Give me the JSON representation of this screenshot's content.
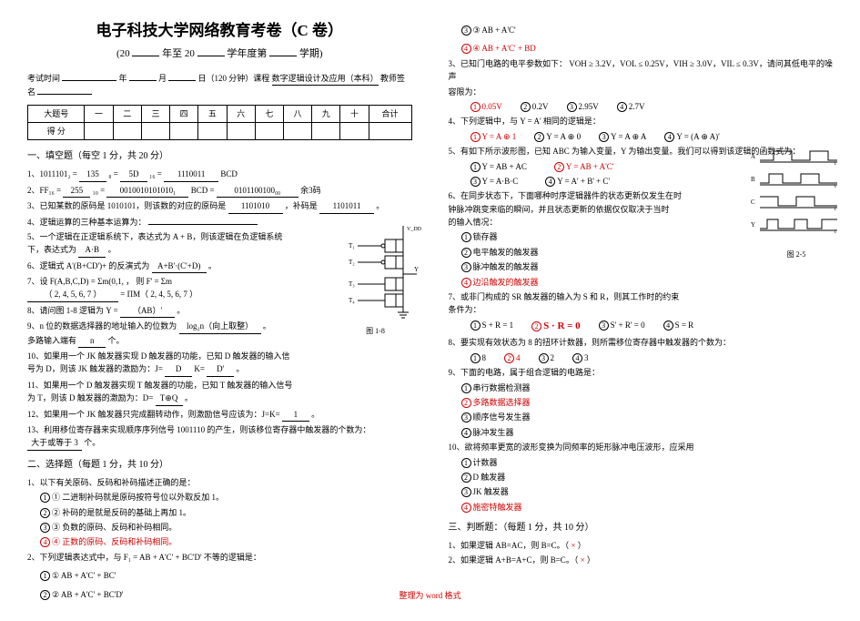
{
  "header": {
    "title": "电子科技大学网络教育考卷（C 卷）",
    "subtitle_a": "(20",
    "subtitle_b": "年至 20",
    "subtitle_c": "学年度第",
    "subtitle_d": "学期)",
    "meta_exam_time": "考试时间",
    "meta_year": "年",
    "meta_month": "月",
    "meta_day": "日（120 分钟）课程",
    "meta_course": "数字逻辑设计及应用（本科）",
    "meta_teacher": "教师签名"
  },
  "score_table": {
    "row1_label": "大题号",
    "cols": [
      "一",
      "二",
      "三",
      "四",
      "五",
      "六",
      "七",
      "八",
      "九",
      "十",
      "合计"
    ],
    "row2_label": "得  分"
  },
  "sec1": {
    "head": "一、填空题（每空 1 分，共 20 分）",
    "q1a": "1、1011101₂ =",
    "q1b": "135",
    "q1c": "₈ =",
    "q1d": "5D",
    "q1e": "₁₆ =",
    "q1f": "1110011",
    "q1g": "BCD",
    "q2a": "2、FF₁₆ =",
    "q2b": "255",
    "q2c": "₁₀ =",
    "q2d": "0010010101010₁",
    "q2e": "BCD =",
    "q2f": "0101100100₀₀",
    "q2g": "余3码",
    "q3a": "3、已知某数的原码是 1010101，则该数的对应的原码是",
    "q3b": "1101010",
    "q3c": "，补码是",
    "q3d": "1101011",
    "q3e": "。",
    "q4": "4、逻辑运算的三种基本运算为：",
    "q5a": "5、一个逻辑在正逻辑系统下，表达式为 A + B，则该逻辑在负逻辑系统",
    "q5b": "下，表达式为",
    "q5c": "A·B",
    "q5d": "。",
    "q6a": "6、逻辑式 A'(B+CD')+ 的反演式为",
    "q6b": "A+B'·(C'+D)",
    "q6c": "。",
    "q7a": "7、设",
    "q7b": "F(A,B,C,D) = Σm(0,1,",
    "q7c": "，    则",
    "q7d": "F' = Σm",
    "q7e": "（   2, 4, 5, 6, 7   ）",
    "q7f": " = ΠM（   2, 4, 5, 6, 7   ）",
    "q8a": "8、请问图 1-8 逻辑为 Y =",
    "q8b": "（AB）'",
    "q8c": "。",
    "q9a": "9、n 位的数据选择器的地址输入的位数为",
    "q9b": "log₂n（向上取整）",
    "q9c": "。",
    "q9d": "多路输入端有",
    "q9e": "n",
    "q9f": "个。",
    "q10a": "10、如果用一个 JK 触发器实现 D 触发器的功能，已知 D 触发器的输入信",
    "q10b": "号为 D，则该 JK 触发器的激励为：J=",
    "q10c": "D",
    "q10d": "K=",
    "q10e": "D'",
    "q10f": "。",
    "q11a": "11、如果用一个 D 触发器实现 T 触发器的功能，已知 T 触发器的输入信号",
    "q11b": "为 T，则该 D 触发器的激励为：D=",
    "q11c": "T⊕Q",
    "q11d": "。",
    "q12a": "12、如果用一个 JK 触发器只完成翻转动作，则激励信号应该为：J=K=",
    "q12b": "1",
    "q12c": "。",
    "q13a": "13、利用移位寄存器来实现顺序序列信号 1001110 的产生，则该移位寄存器中触发器的个数为：",
    "q13b": "大于或等于 3",
    "q13c": "个。",
    "fig_label": "图 1-8"
  },
  "sec2": {
    "head": "二、选择题（每题 1 分，共 10 分）",
    "q1": "1、以下有关原码、反码和补码描述正确的是：",
    "q1o1": "① 二进制补码就是原码按符号位以外取反加 1。",
    "q1o2": "② 补码的是就是反码的基础上再加 1。",
    "q1o3": "③ 负数的原码、反码和补码相同。",
    "q1o4": "④ 正数的原码、反码和补码相同。",
    "q2": "2、下列逻辑表达式中，与 F₁ = AB + A'C' + BC'D' 不等的逻辑是：",
    "q2o1": "① AB + A'C' + BC'",
    "q2o2": "② AB + A'C' + BC'D'",
    "q2o3": "③ AB + A'C'",
    "q2o4": "④ AB + A'C' + BD"
  },
  "col2": {
    "q3a": "3、已知门电路的电平参数如下：",
    "q3b": "VOH ≥ 3.2V，VOL ≤ 0.25V，VIH ≥ 3.0V，VIL ≤ 0.3V，请问其低电平的噪声",
    "q3c": "容限为：",
    "q3o1": "0.05V",
    "q3o2": "0.2V",
    "q3o3": "2.95V",
    "q3o4": "2.7V",
    "q4": "4、下列逻辑中，与 Y = A' 相同的逻辑是：",
    "q4o1": "Y = A ⊕ 1",
    "q4o2": "Y = A ⊕ 0",
    "q4o3": "Y = A ⊕ A",
    "q4o4": "Y = (A ⊕ A)'",
    "q5a": "5、有如下所示波形图，已知 ABC 为输入变量，Y 为输出变量。我们可以得到该逻辑的函数式为：",
    "q5o1": "Y = AB + AC",
    "q5o2": "Y = AB + A'C'",
    "q5o3": "Y = A·B·C",
    "q5o4": "Y = A' + B' + C'",
    "q6a": "6、在同步状态下，下面哪种时序逻辑器件的状态更新仅发生在时",
    "q6b": "钟脉冲跳变来临的瞬间，并且状态更新的依据仅仅取决于当时",
    "q6c": "的输入情况：",
    "q6o1": "锁存器",
    "q6o2": "电平触发的触发器",
    "q6o3": "脉冲触发的触发器",
    "q6o4": "边沿触发的触发器",
    "q7a": "7、或非门构成的 SR 触发器的输入为 S 和 R，则其工作时的约束",
    "q7b": "条件为：",
    "q7o1": "S + R = 1",
    "q7o2": "S · R = 0",
    "q7o3": "S' + R' = 0",
    "q7o4": "S = R",
    "q8": "8、要实现有效状态为 8 的扭环计数器，则所需移位寄存器中触发器的个数为：",
    "q8o1": "8",
    "q8o2": "4",
    "q8o3": "2",
    "q8o4": "3",
    "q9": "9、下面的电路，属于组合逻辑的电路是：",
    "q9o1": "串行数据检测器",
    "q9o2": "多路数据选择器",
    "q9o3": "顺序信号发生器",
    "q9o4": "脉冲发生器",
    "q10": "10、欲将频率更宽的波形变换为同频率的矩形脉冲电压波形，应采用",
    "q10o1": "计数器",
    "q10o2": "D 触发器",
    "q10o3": "JK 触发器",
    "q10o4": "施密特触发器",
    "fig_label": "图 2-5"
  },
  "sec3": {
    "head": "三、判断题：（每题 1 分，共 10 分）",
    "q1": "1、如果逻辑 AB=AC，则 B=C。（",
    "q1ans": "×",
    "q2": "2、如果逻辑 A+B=A+C，则 B=C。（",
    "q2ans": "×",
    "paren_close": "）"
  },
  "footer": "整理为 word 格式"
}
